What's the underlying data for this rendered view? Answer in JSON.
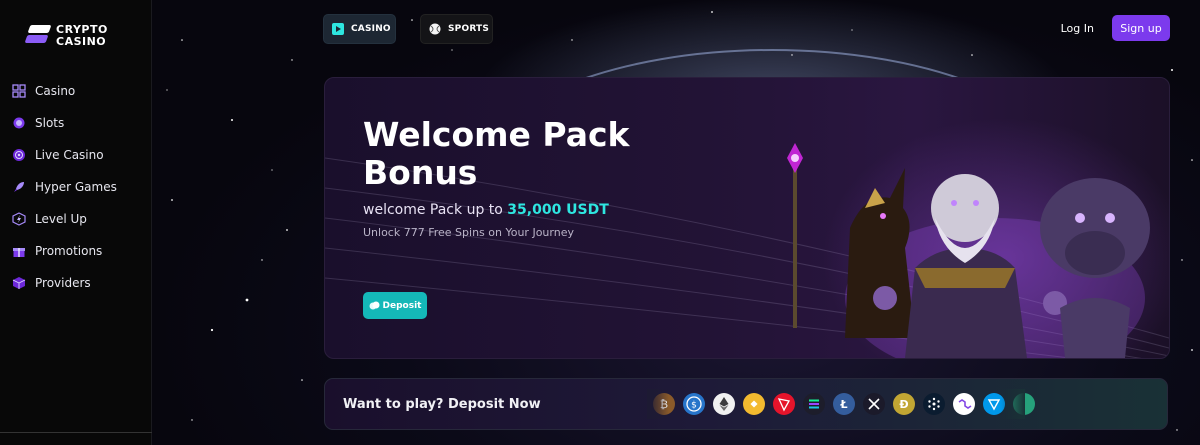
{
  "brand": {
    "line1": "CRYPTO",
    "line2": "CASINO"
  },
  "sidebar": {
    "items": [
      {
        "label": "Casino",
        "icon": "grid-icon"
      },
      {
        "label": "Slots",
        "icon": "cherry-icon"
      },
      {
        "label": "Live Casino",
        "icon": "roulette-icon"
      },
      {
        "label": "Hyper Games",
        "icon": "rocket-icon"
      },
      {
        "label": "Level Up",
        "icon": "level-up-icon"
      },
      {
        "label": "Promotions",
        "icon": "gift-icon"
      },
      {
        "label": "Providers",
        "icon": "cube-icon"
      }
    ]
  },
  "header": {
    "tabs": [
      {
        "label": "CASINO",
        "icon": "casino-chip-icon",
        "active": true
      },
      {
        "label": "SPORTS",
        "icon": "ball-icon",
        "active": false
      }
    ],
    "login_label": "Log In",
    "signup_label": "Sign up"
  },
  "banner": {
    "title_line1": "Welcome Pack",
    "title_line2": "Bonus",
    "subtitle_prefix": "welcome Pack up to ",
    "subtitle_amount": "35,000 USDT",
    "note": "Unlock 777 Free Spins on Your Journey",
    "button_label": "Deposit"
  },
  "deposit_strip": {
    "label": "Want to play? Deposit Now",
    "coins": [
      "bitcoin-icon",
      "usdc-icon",
      "ethereum-icon",
      "binance-icon",
      "tron-icon",
      "solana-icon",
      "litecoin-icon",
      "xrp-icon",
      "dogecoin-icon",
      "cardano-icon",
      "polygon-icon",
      "toncoin-icon",
      "tether-icon"
    ]
  },
  "colors": {
    "accent": "#7c3aed",
    "deposit": "#14b8b8",
    "highlight": "#2ee6e0",
    "sidebar_bg": "#080808"
  }
}
